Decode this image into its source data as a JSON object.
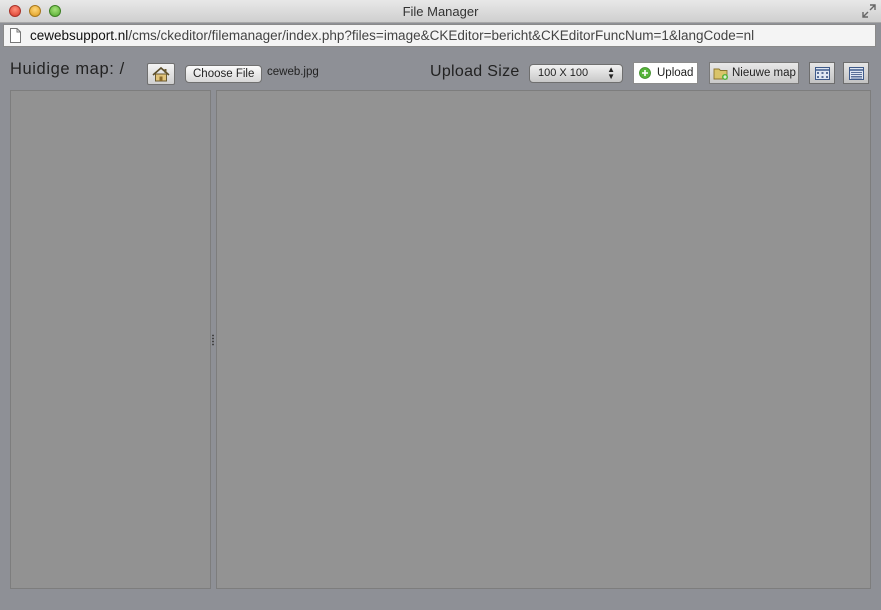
{
  "window": {
    "title": "File Manager"
  },
  "address_bar": {
    "domain": "cewebsupport.nl",
    "path": "/cms/ckeditor/filemanager/index.php?files=image&CKEditor=bericht&CKEditorFuncNum=1&langCode=nl"
  },
  "toolbar": {
    "current_folder_label": "Huidige map: /",
    "home_icon": "home-icon",
    "choose_file_label": "Choose File",
    "selected_file": "ceweb.jpg",
    "upload_size_label": "Upload Size",
    "upload_size_value": "100 X 100",
    "upload_label": "Upload",
    "upload_icon": "plus-circle-icon",
    "new_folder_label": "Nieuwe map",
    "new_folder_icon": "folder-plus-icon",
    "grid_view_icon": "grid-view-icon",
    "list_view_icon": "list-view-icon"
  },
  "colors": {
    "overlay_bg": "#8e9096",
    "pane_bg": "#939393",
    "upload_icon_green": "#56b43a"
  }
}
